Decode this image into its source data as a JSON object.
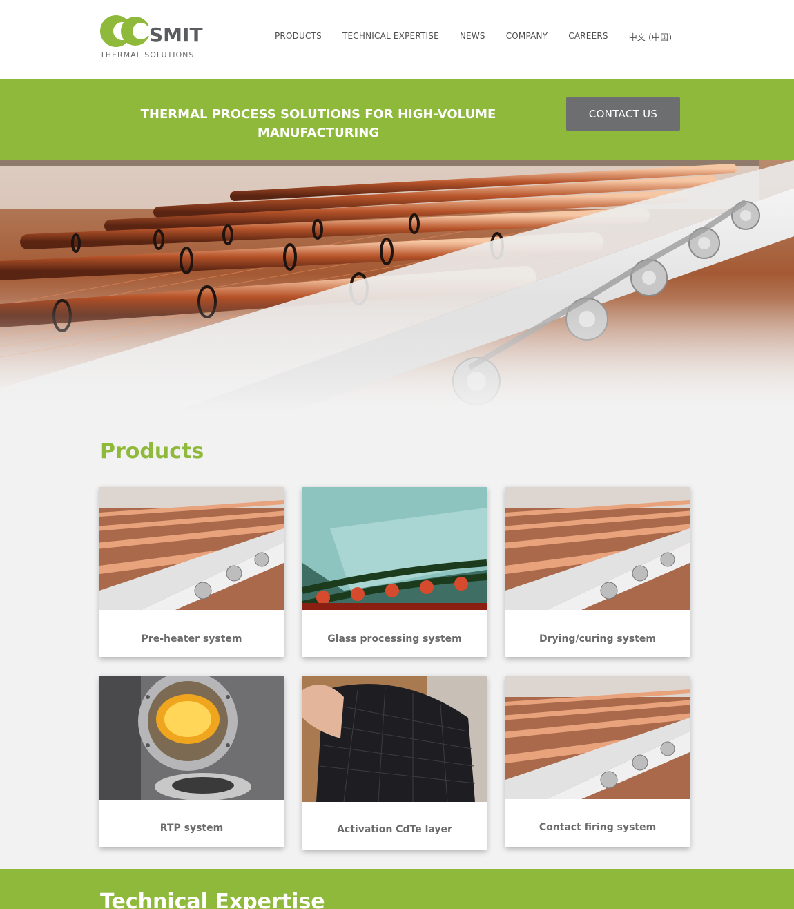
{
  "brand": {
    "name": "SMIT",
    "tagline": "THERMAL SOLUTIONS",
    "accent_color": "#8fb93a",
    "text_color": "#5a5c5f"
  },
  "nav": {
    "items": [
      "PRODUCTS",
      "TECHNICAL EXPERTISE",
      "NEWS",
      "COMPANY",
      "CAREERS",
      "中文 (中国)"
    ]
  },
  "banner": {
    "title_line1": "THERMAL PROCESS SOLUTIONS FOR HIGH-VOLUME",
    "title_line2": "MANUFACTURING",
    "contact_label": "CONTACT US",
    "button_color": "#6d6e70"
  },
  "products": {
    "title": "Products",
    "items": [
      {
        "label": "Pre-heater system",
        "image": "copper-roller-furnace"
      },
      {
        "label": "Glass processing system",
        "image": "glass-on-rollers"
      },
      {
        "label": "Drying/curing system",
        "image": "copper-roller-furnace"
      },
      {
        "label": "RTP system",
        "image": "rtp-chamber"
      },
      {
        "label": "Activation CdTe layer",
        "image": "flexible-solar-panel"
      },
      {
        "label": "Contact firing system",
        "image": "copper-roller-furnace"
      }
    ]
  },
  "expertise": {
    "title": "Technical Expertise"
  }
}
